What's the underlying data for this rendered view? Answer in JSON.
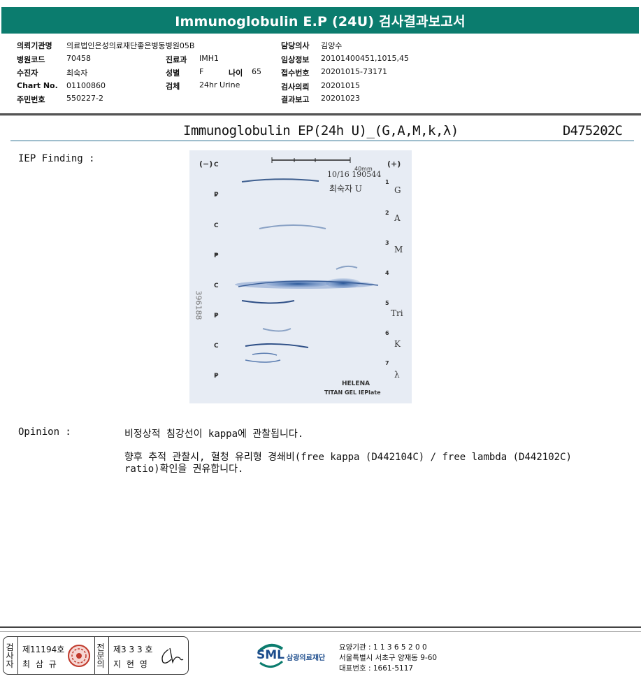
{
  "title": "Immunoglobulin E.P (24U) 검사결과보고서",
  "info": {
    "institution_label": "의뢰기관명",
    "institution": "의료법인은성의료재단좋은병동병원05B",
    "hospital_code_label": "병원코드",
    "hospital_code": "70458",
    "patient_label": "수진자",
    "patient": "최숙자",
    "chart_label": "Chart No.",
    "chart_no": "01100860",
    "resident_label": "주민번호",
    "resident_no": "550227-2",
    "dept_label": "진료과",
    "dept": "IMH1",
    "sex_label": "성별",
    "sex": "F",
    "age_label": "나이",
    "age": "65",
    "specimen_label": "검체",
    "specimen": "24hr Urine",
    "doctor_label": "담당의사",
    "doctor": "김양수",
    "clinical_label": "임상정보",
    "clinical": "20101400451,1015,45",
    "receipt_label": "접수번호",
    "receipt": "20201015-73171",
    "request_label": "검사의뢰",
    "request": "20201015",
    "report_label": "결과보고",
    "report": "20201023"
  },
  "test_name": "Immunoglobulin EP(24h U)_(G,A,M,k,λ)",
  "test_code": "D475202C",
  "finding_label": "IEP Finding :",
  "gel": {
    "minus": "(−)",
    "plus": "(+)",
    "scale": "40mm",
    "handwritten_date": "10/16 190544",
    "handwritten_name": "최숙자 U",
    "left_letters": [
      "C",
      "P",
      "C",
      "P",
      "C",
      "P",
      "C",
      "P"
    ],
    "numbers": [
      "1",
      "2",
      "3",
      "4",
      "5",
      "6",
      "7"
    ],
    "antisera": [
      "G",
      "A",
      "M",
      "Tri",
      "K",
      "λ"
    ],
    "side_code": "396188",
    "brand1": "HELENA",
    "brand2": "TITAN GEL IEPlate"
  },
  "opinion_label": "Opinion :",
  "opinion_lines": [
    "비정상적 침강선이 kappa에 관찰됩니다.",
    "향후 추적 관찰시, 혈청 유리형 경쇄비(free kappa (D442104C) / free lambda (D442102C)",
    "ratio)확인을 권유합니다."
  ],
  "signature": {
    "examiner_v": "검사자",
    "examiner_license": "제11194호",
    "examiner_name": "최 삼 규",
    "doctor_v": "전문의",
    "doctor_license": "제3 3 3 호",
    "doctor_name": "지 현 영"
  },
  "footer": {
    "org_logo": "SML",
    "org_name": "삼광의료재단",
    "line1": "요양기관 : 1 1 3 6 5 2 0 0",
    "line2": "서울특별시 서초구 양재동 9-60",
    "line3": "대표번호 : 1661-5117"
  },
  "colors": {
    "header": "#0b7c6e",
    "gel_bg": "#e7ecf4",
    "band": "#2f5f9c",
    "seal": "#c0392b"
  }
}
